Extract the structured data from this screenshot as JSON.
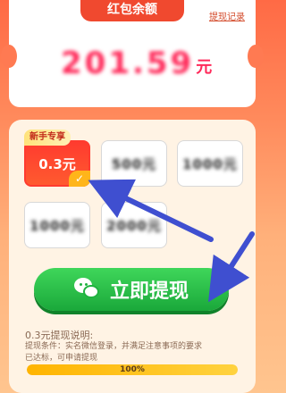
{
  "header": {
    "title": "红包余额",
    "withdraw_record": "提现记录"
  },
  "balance": {
    "amount_obscured": "201.59",
    "unit": "元"
  },
  "options": [
    {
      "label": "0.3元",
      "selected": true,
      "badge": "新手专享"
    },
    {
      "label": "500元",
      "obscured": true
    },
    {
      "label": "1000元",
      "obscured": true
    },
    {
      "label": "1000元",
      "obscured": true
    },
    {
      "label": "2000元",
      "obscured": true
    }
  ],
  "cta": {
    "label": "立即提现",
    "icon": "wechat-icon"
  },
  "description": {
    "title": "0.3元提现说明:",
    "line1": "提现条件：实名微信登录，并满足注意事项的要求",
    "line2": "已达标，可申请提现"
  },
  "progress": {
    "value": 1.0,
    "label": "100%"
  },
  "colors": {
    "accent_red": "#f0492f",
    "cta_green": "#1aa83a",
    "arrow_blue": "#3f4fd0"
  }
}
